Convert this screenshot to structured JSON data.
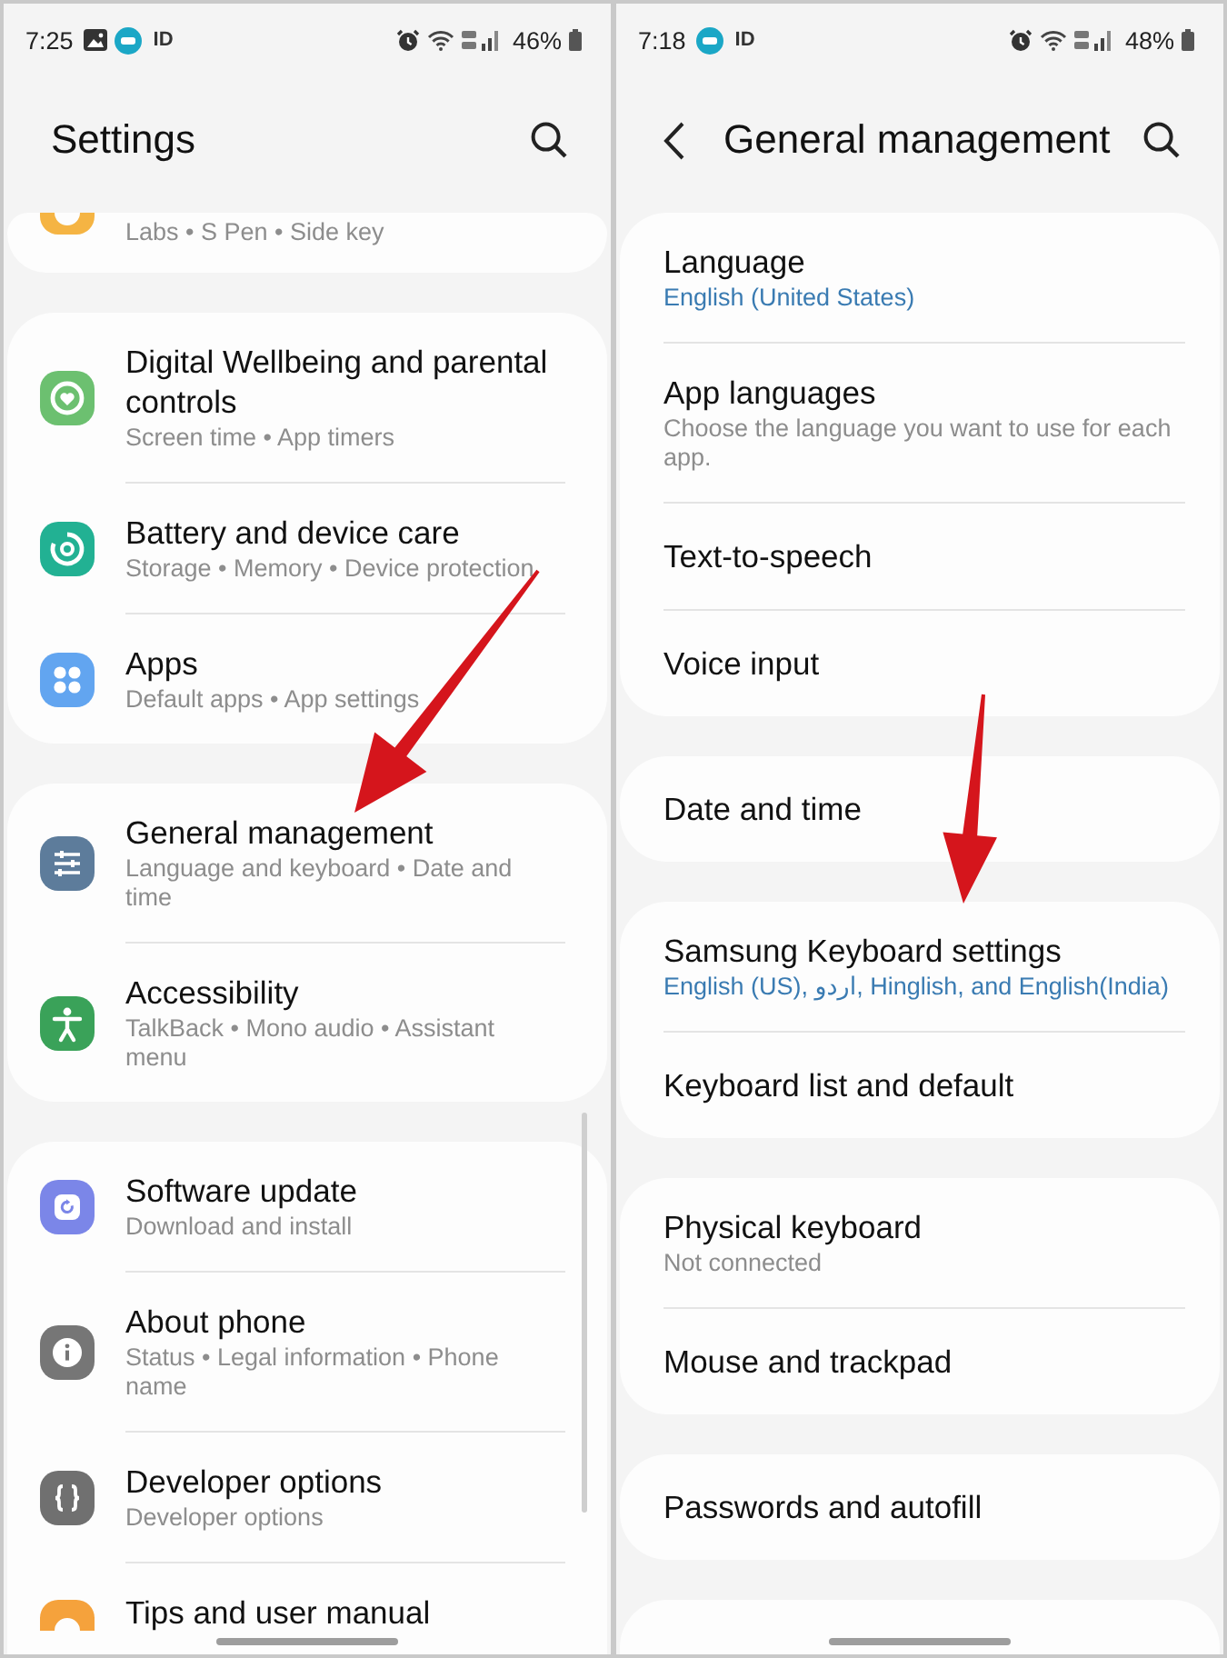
{
  "screens": [
    {
      "status_bar": {
        "time": "7:25",
        "notifications": [
          {
            "kind": "gallery"
          },
          {
            "kind": "badge"
          },
          {
            "kind": "label",
            "text": "ID"
          }
        ],
        "alarm": true,
        "battery": "46%"
      },
      "header": {
        "back": false,
        "title": "Settings"
      },
      "scrollbar": true,
      "groups": [
        {
          "kind": "partial_top",
          "items": [
            {
              "kind": "advanced",
              "color": "#f5b443",
              "subtitle": "Labs • S Pen • Side key",
              "current_value": false,
              "arrow": false
            }
          ]
        },
        {
          "kind": "full",
          "items": [
            {
              "kind": "wellbeing",
              "color": "#6cc070",
              "title": "Digital Wellbeing and parental controls",
              "subtitle": "Screen time • App timers",
              "current_value": false,
              "arrow": false
            },
            {
              "kind": "battery",
              "color": "#22b193",
              "title": "Battery and device care",
              "subtitle": "Storage • Memory • Device protection",
              "current_value": false,
              "arrow": false
            },
            {
              "kind": "apps",
              "color": "#62a5f0",
              "title": "Apps",
              "subtitle": "Default apps • App settings",
              "current_value": false,
              "arrow": false
            }
          ]
        },
        {
          "kind": "full",
          "items": [
            {
              "kind": "general",
              "color": "#5d7c9b",
              "title": "General management",
              "subtitle": "Language and keyboard • Date and time",
              "current_value": false,
              "arrow": true
            },
            {
              "kind": "accessibility",
              "color": "#3aa259",
              "title": "Accessibility",
              "subtitle": "TalkBack • Mono audio • Assistant menu",
              "current_value": false,
              "arrow": false
            }
          ]
        },
        {
          "kind": "partial_bottom",
          "items": [
            {
              "kind": "update",
              "color": "#7b86e8",
              "title": "Software update",
              "subtitle": "Download and install",
              "current_value": false,
              "arrow": false
            },
            {
              "kind": "about",
              "color": "#767676",
              "title": "About phone",
              "subtitle": "Status • Legal information • Phone name",
              "current_value": false,
              "arrow": false
            },
            {
              "kind": "developer",
              "color": "#707070",
              "title": "Developer options",
              "subtitle": "Developer options",
              "current_value": false,
              "arrow": false
            },
            {
              "kind": "tips",
              "color": "#f5a23c",
              "title": "Tips and user manual",
              "arrow": false
            }
          ]
        }
      ]
    },
    {
      "status_bar": {
        "time": "7:18",
        "notifications": [
          {
            "kind": "badge"
          },
          {
            "kind": "label",
            "text": "ID"
          }
        ],
        "alarm": true,
        "battery": "48%"
      },
      "header": {
        "back": true,
        "title": "General management"
      },
      "scrollbar": false,
      "groups": [
        {
          "kind": "full",
          "items": [
            {
              "title": "Language",
              "subtitle": "English (United States)",
              "current_value": true,
              "arrow": false
            },
            {
              "title": "App languages",
              "subtitle": "Choose the language you want to use for each app.",
              "current_value": false,
              "arrow": false
            },
            {
              "title": "Text-to-speech",
              "arrow": false
            },
            {
              "title": "Voice input",
              "arrow": false
            }
          ]
        },
        {
          "kind": "full",
          "items": [
            {
              "title": "Date and time",
              "arrow": false
            }
          ]
        },
        {
          "kind": "full",
          "items": [
            {
              "title": "Samsung Keyboard settings",
              "subtitle": "English (US), اردو, Hinglish, and English(India)",
              "current_value": true,
              "arrow": true
            },
            {
              "title": "Keyboard list and default",
              "arrow": false
            }
          ]
        },
        {
          "kind": "full",
          "items": [
            {
              "title": "Physical keyboard",
              "subtitle": "Not connected",
              "current_value": false,
              "arrow": false
            },
            {
              "title": "Mouse and trackpad",
              "arrow": false
            }
          ]
        },
        {
          "kind": "full",
          "items": [
            {
              "title": "Passwords and autofill",
              "arrow": false
            }
          ]
        },
        {
          "kind": "partial_bottom"
        }
      ]
    }
  ]
}
